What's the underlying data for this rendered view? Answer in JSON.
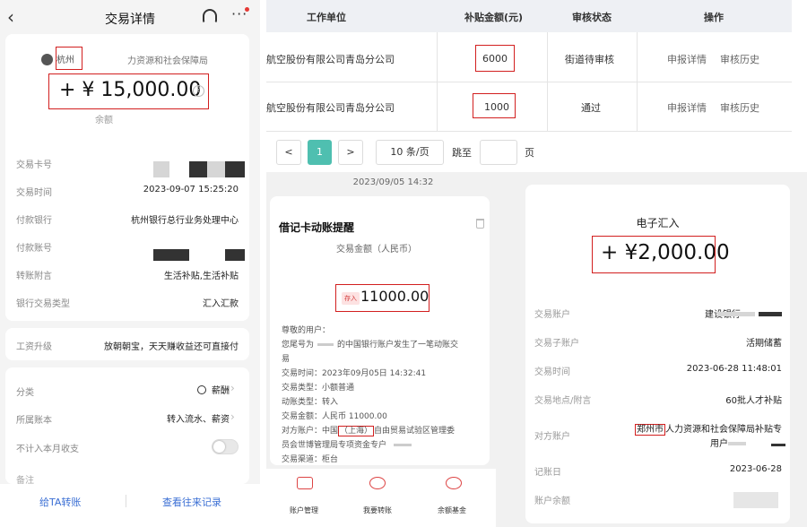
{
  "panel_a": {
    "back_icon": "back-arrow-icon",
    "title": "交易详情",
    "payee_prefix": "杭州",
    "payee_suffix": "力资源和社会保障局",
    "amount": "+ ¥ 15,000.00",
    "balance_label": "余额",
    "rows": [
      {
        "label": "交易卡号",
        "value": ""
      },
      {
        "label": "交易时间",
        "value": "2023-09-07 15:25:20"
      },
      {
        "label": "付款银行",
        "value": "杭州银行总行业务处理中心"
      },
      {
        "label": "付款账号",
        "value": ""
      },
      {
        "label": "转账附言",
        "value": "生活补贴,生活补贴"
      },
      {
        "label": "银行交易类型",
        "value": "汇入汇款"
      }
    ],
    "salary_label": "工资升级",
    "salary_value": "放朝朝宝，天天赚收益还可直接付",
    "cat_rows": [
      {
        "label": "分类",
        "value": "薪酬"
      },
      {
        "label": "所属账本",
        "value": "转入流水、薪资"
      },
      {
        "label": "不计入本月收支",
        "value": ""
      },
      {
        "label": "备注",
        "value": ""
      }
    ],
    "btn_transfer": "给TA转账",
    "btn_history": "查看往来记录"
  },
  "panel_b": {
    "headers": [
      "工作单位",
      "补贴金额(元)",
      "审核状态",
      "操作"
    ],
    "rows": [
      {
        "unit": "航空股份有限公司青岛分公司",
        "amount": "6000",
        "status": "街道待审核",
        "op1": "申报详情",
        "op2": "审核历史"
      },
      {
        "unit": "航空股份有限公司青岛分公司",
        "amount": "1000",
        "status": "通过",
        "op1": "申报详情",
        "op2": "审核历史"
      }
    ],
    "pager": {
      "prev": "<",
      "page": "1",
      "next": ">",
      "size": "10 条/页",
      "jump": "跳至",
      "page_unit": "页"
    }
  },
  "panel_c": {
    "timestamp": "2023/09/05 14:32",
    "title": "借记卡动账提醒",
    "sub": "交易金额（人民币）",
    "tag": "存入",
    "amount": "11000.00",
    "lines": [
      "尊敬的用户：",
      "您尾号为",
      "的中国银行账户发生了一笔动账交",
      "易",
      "交易时间：2023年09月05日 14:32:41",
      "交易类型：小额普通",
      "动账类型：转入",
      "交易金额：人民币 11000.00",
      "对方账户：中国",
      "（上海）",
      "自由贸易试验区管理委",
      "员会世博管理局专项资金专户",
      "交易渠道：柜台"
    ],
    "bottom_items": [
      "账户管理",
      "我要转账",
      "余额基金"
    ]
  },
  "panel_d": {
    "head": "电子汇入",
    "amount": "+ ¥2,000.00",
    "rows": [
      {
        "label": "交易账户",
        "value": "建设银行"
      },
      {
        "label": "交易子账户",
        "value": "活期储蓄"
      },
      {
        "label": "交易时间",
        "value": "2023-06-28 11:48:01"
      },
      {
        "label": "交易地点/附言",
        "value": "60批人才补贴"
      },
      {
        "label": "对方账户",
        "value": "郑州市"
      },
      {
        "label": "对方账户续",
        "value": "人力资源和社会保障局补贴专"
      },
      {
        "label": "对方账户续2",
        "value": "用户"
      },
      {
        "label": "记账日",
        "value": "2023-06-28"
      },
      {
        "label": "账户余额",
        "value": ""
      }
    ]
  }
}
